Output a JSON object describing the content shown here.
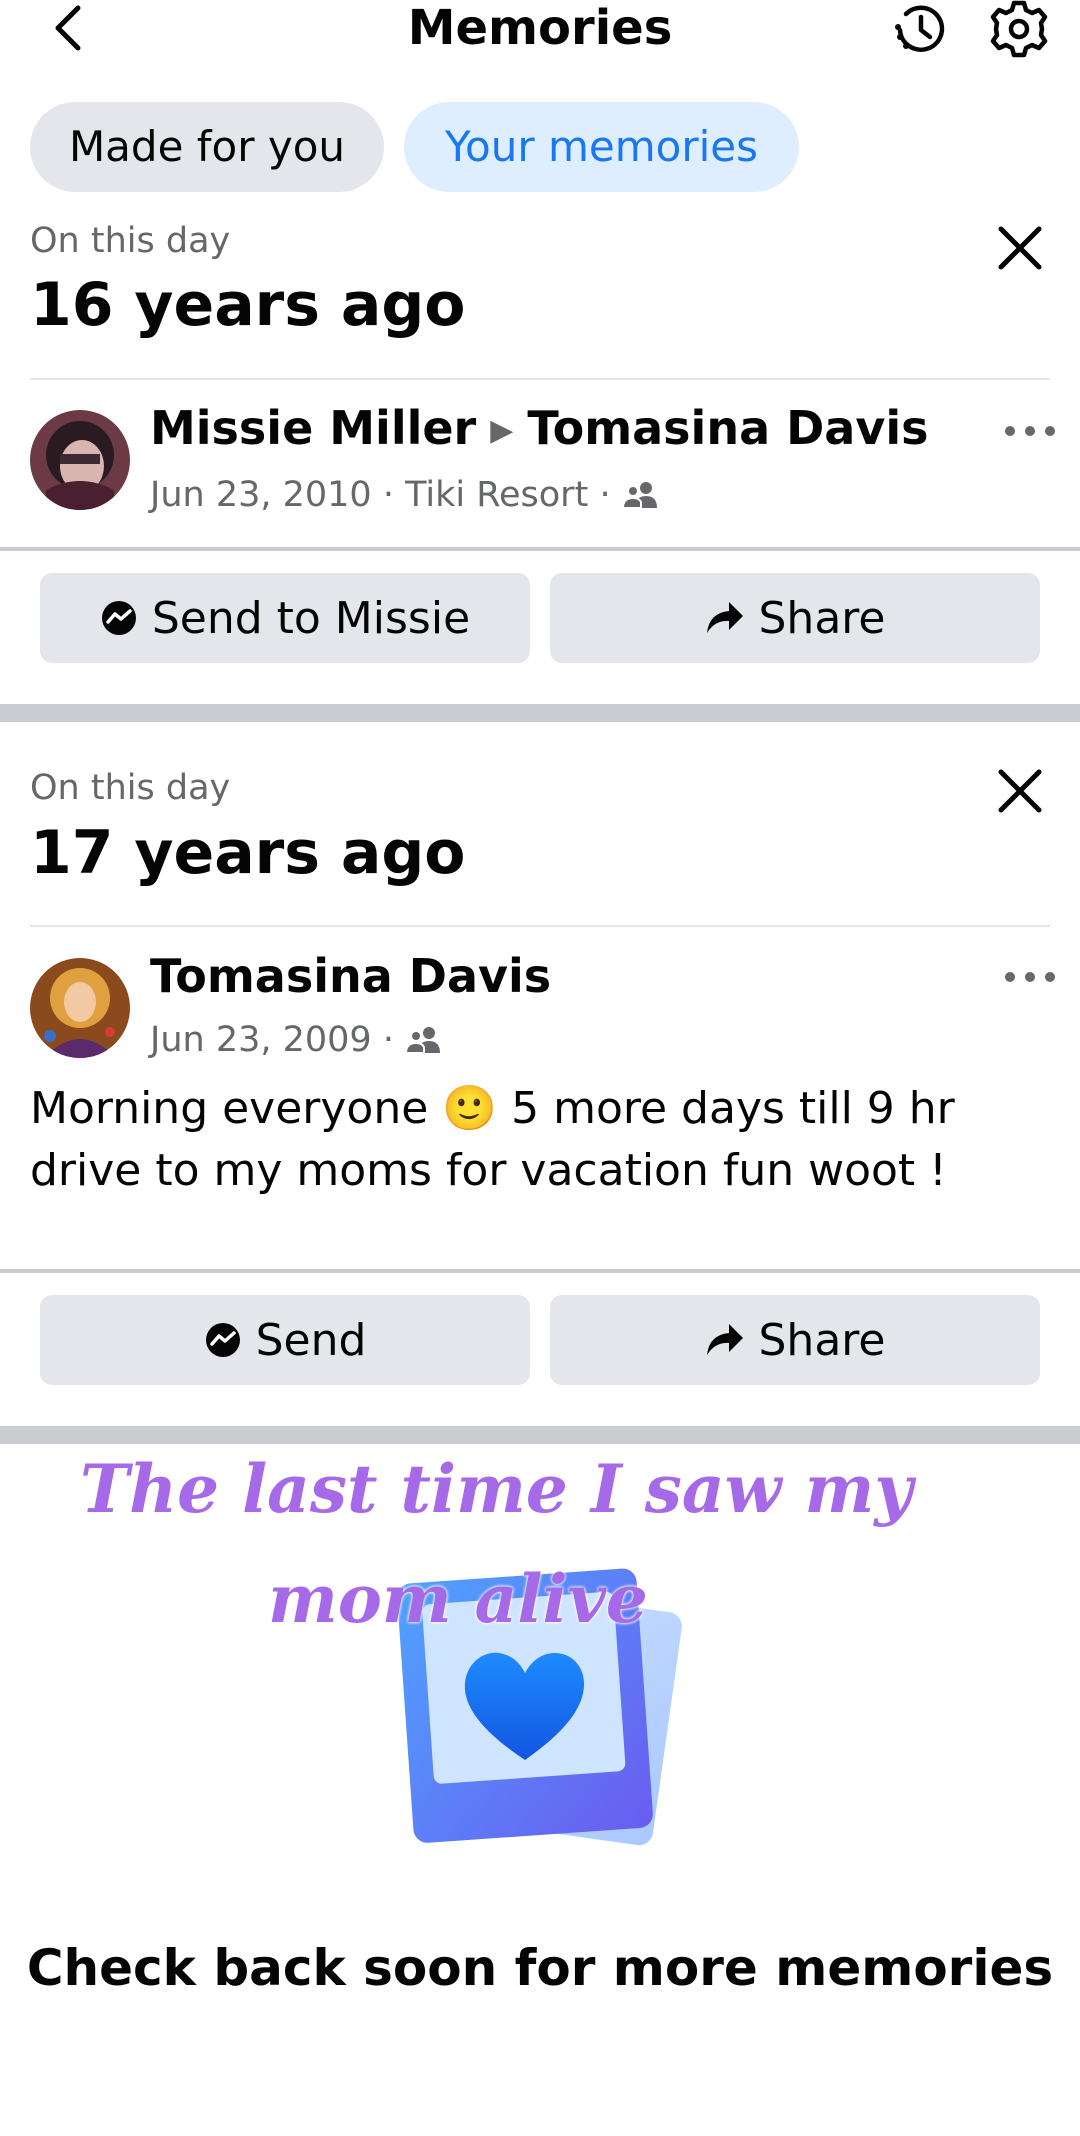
{
  "header": {
    "title": "Memories",
    "back_icon": "chevron-left-icon",
    "history_icon": "history-clock-icon",
    "settings_icon": "gear-icon"
  },
  "tabs": [
    {
      "label": "Made for you",
      "active": false
    },
    {
      "label": "Your memories",
      "active": true
    }
  ],
  "colors": {
    "accent": "#1877f2",
    "active_tab_bg": "#dfeeff",
    "button_bg": "#e4e6eb",
    "overlay_text": "#a66ae8"
  },
  "memories": [
    {
      "eyebrow": "On this day",
      "years_ago": "16 years ago",
      "author": "Missie Miller",
      "recipient": "Tomasina Davis",
      "date": "Jun 23, 2010",
      "location": "Tiki Resort",
      "separator": "·",
      "audience_icon": "friends-icon",
      "actions": [
        {
          "label": "Send to Missie",
          "icon": "messenger-icon"
        },
        {
          "label": "Share",
          "icon": "share-arrow-icon"
        }
      ]
    },
    {
      "eyebrow": "On this day",
      "years_ago": "17 years ago",
      "author": "Tomasina Davis",
      "date": "Jun 23, 2009",
      "separator": "·",
      "audience_icon": "friends-icon",
      "text_before_emoji": "Morning everyone",
      "emoji": "🙂",
      "text_after_emoji": "5 more days till 9 hr drive to my moms for vacation fun woot !",
      "actions": [
        {
          "label": "Send",
          "icon": "messenger-icon"
        },
        {
          "label": "Share",
          "icon": "share-arrow-icon"
        }
      ]
    }
  ],
  "overlay_caption": {
    "line1": "The last time I saw my",
    "line2": "mom alive"
  },
  "empty_state": {
    "illustration": "memories-heart-photo-icon",
    "message": "Check back soon for more memories"
  }
}
